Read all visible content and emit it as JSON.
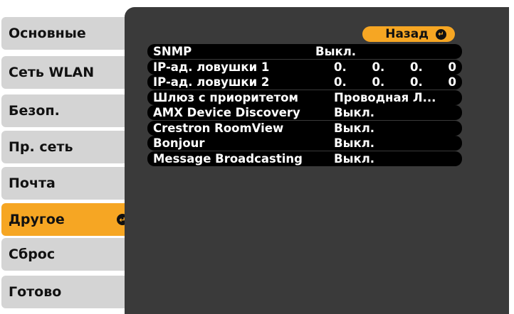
{
  "tabs": [
    {
      "label": "Основные",
      "active": false
    },
    {
      "label": "Сеть WLAN",
      "active": false
    },
    {
      "label": "Безоп.",
      "active": false
    },
    {
      "label": "Пр. сеть",
      "active": false
    },
    {
      "label": "Почта",
      "active": false
    },
    {
      "label": "Другое",
      "active": true
    },
    {
      "label": "Сброс",
      "active": false
    },
    {
      "label": "Готово",
      "active": false
    }
  ],
  "back_button": {
    "label": "Назад"
  },
  "settings": [
    {
      "label": "SNMP",
      "value": "Выкл."
    },
    {
      "label": "IP-ад. ловушки 1",
      "ip": [
        "0.",
        "0.",
        "0.",
        "0"
      ]
    },
    {
      "label": "IP-ад. ловушки 2",
      "ip": [
        "0.",
        "0.",
        "0.",
        "0"
      ]
    },
    {
      "label": "Шлюз с приоритетом",
      "value": "Проводная Л..."
    },
    {
      "label": "AMX Device Discovery",
      "value": "Выкл."
    },
    {
      "label": "Crestron RoomView",
      "value": "Выкл."
    },
    {
      "label": "Bonjour",
      "value": "Выкл."
    },
    {
      "label": "Message Broadcasting",
      "value": "Выкл."
    }
  ],
  "colors": {
    "accent": "#f6a623",
    "panel": "#3a3a3a",
    "tab": "#d4d4d4",
    "row": "#000000"
  }
}
